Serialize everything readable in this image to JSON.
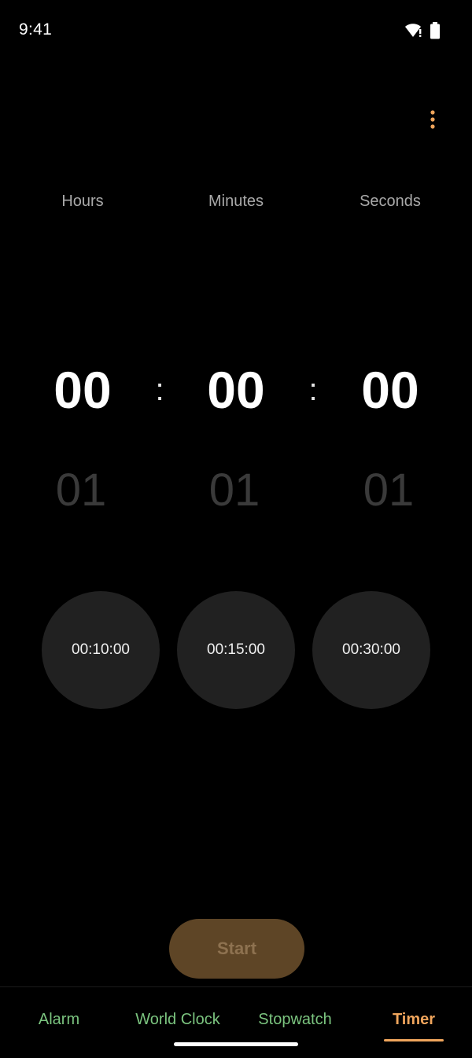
{
  "status_bar": {
    "time": "9:41",
    "icons": [
      "wifi-alert-icon",
      "battery-icon"
    ]
  },
  "toolbar": {
    "overflow_icon": "more-vert-icon"
  },
  "picker": {
    "labels": {
      "hours": "Hours",
      "minutes": "Minutes",
      "seconds": "Seconds"
    },
    "current": {
      "hours": "00",
      "minutes": "00",
      "seconds": "00"
    },
    "next": {
      "hours": "01",
      "minutes": "01",
      "seconds": "01"
    },
    "separator": ":"
  },
  "presets": [
    "00:10:00",
    "00:15:00",
    "00:30:00"
  ],
  "start_button": {
    "label": "Start"
  },
  "bottom_nav": {
    "items": [
      {
        "label": "Alarm",
        "active": false
      },
      {
        "label": "World Clock",
        "active": false
      },
      {
        "label": "Stopwatch",
        "active": false
      },
      {
        "label": "Timer",
        "active": true
      }
    ]
  },
  "colors": {
    "accent": "#f0a55c",
    "nav_inactive": "#7bc47f",
    "start_button_bg": "#5e4526",
    "preset_bg": "#212121",
    "background": "#000000"
  }
}
